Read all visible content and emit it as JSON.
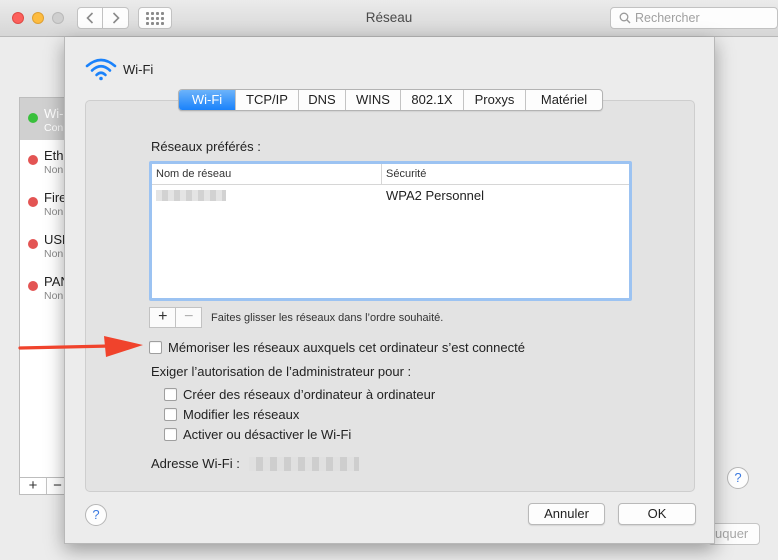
{
  "window": {
    "title": "Réseau",
    "search_placeholder": "Rechercher",
    "background_button": "uquer"
  },
  "sidebar": {
    "items": [
      {
        "name": "Wi-Fi",
        "status": "Connecté",
        "color": "#39c03c"
      },
      {
        "name": "Ethernet",
        "status": "Non connecté",
        "color": "#e35453"
      },
      {
        "name": "FireWire",
        "status": "Non connecté",
        "color": "#e35453"
      },
      {
        "name": "USB",
        "status": "Non connecté",
        "color": "#e35453"
      },
      {
        "name": "PAN",
        "status": "Non connecté",
        "color": "#e35453"
      }
    ],
    "add_label": "+",
    "remove_label": "−"
  },
  "sheet": {
    "title": "Wi-Fi",
    "tabs": [
      {
        "label": "Wi-Fi",
        "active": true
      },
      {
        "label": "TCP/IP",
        "active": false
      },
      {
        "label": "DNS",
        "active": false
      },
      {
        "label": "WINS",
        "active": false
      },
      {
        "label": "802.1X",
        "active": false
      },
      {
        "label": "Proxys",
        "active": false
      },
      {
        "label": "Matériel",
        "active": false
      }
    ],
    "preferred_label": "Réseaux préférés :",
    "table": {
      "headers": [
        "Nom de réseau",
        "Sécurité"
      ],
      "rows": [
        {
          "security": "WPA2 Personnel"
        }
      ]
    },
    "add_label": "+",
    "remove_label": "−",
    "drag_hint": "Faites glisser les réseaux dans l’ordre souhaité.",
    "remember_label": "Mémoriser les réseaux auxquels cet ordinateur s’est connecté",
    "admin_label": "Exiger l’autorisation de l’administrateur pour :",
    "admin_options": [
      "Créer des réseaux d’ordinateur à ordinateur",
      "Modifier les réseaux",
      "Activer ou désactiver le Wi-Fi"
    ],
    "wifi_address_label": "Adresse Wi-Fi :",
    "help_label": "?",
    "cancel_label": "Annuler",
    "ok_label": "OK"
  },
  "colors": {
    "accent": "#1a82fb",
    "annotation_arrow": "#f0432c"
  }
}
